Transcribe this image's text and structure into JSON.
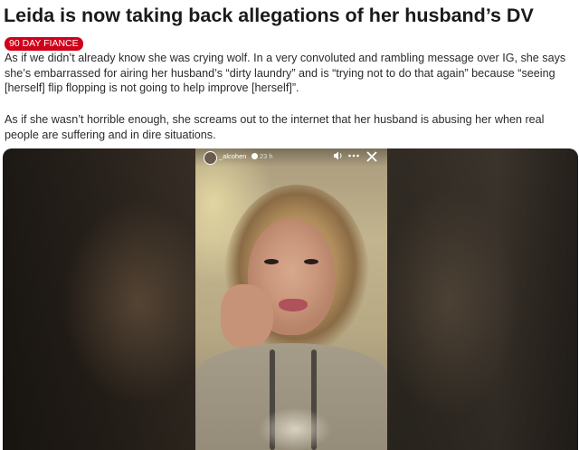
{
  "post": {
    "title": "Leida is now taking back allegations of her husband’s DV",
    "flair": "90 DAY FIANCE",
    "paragraphs": [
      "As if we didn’t already know she was crying wolf. In a very convoluted and rambling message over IG, she says she’s embarrassed for airing her husband’s “dirty laundry” and is “trying not to do that again” because “seeing [herself] flip flopping is not going to help improve [herself]”.",
      "As if she wasn’t horrible enough, she screams out to the internet that her husband is abusing her when real people are suffering and in dire situations."
    ]
  },
  "story": {
    "username": "_alcohen",
    "time": "23 h",
    "icons": {
      "volume": "volume-icon",
      "more": "more-options-icon",
      "close": "close-icon",
      "verified": "verified-badge-icon"
    }
  },
  "colors": {
    "flair_bg": "#d0021b",
    "title_text": "#1a1a1b",
    "body_text": "#2a2a2a"
  }
}
